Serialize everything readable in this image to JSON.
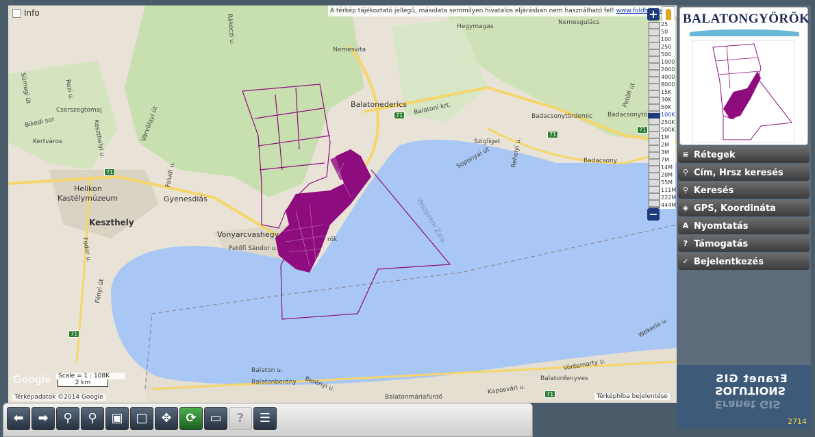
{
  "map": {
    "info_label": "Info",
    "disclaimer": "A térkép tájékoztató jellegű, másolata semmilyen hivatalos eljárásban nem használható fel!",
    "disclaimer_link": "www.foldhivatal.hu",
    "scale_text": "Scale = 1 : 108K",
    "scale_bar": "2 km",
    "google_logo": "Google",
    "map_data": "Térképadatok ©2014 Google",
    "report_error": "Térképhiba bejelentése",
    "labels": {
      "hegymagas": "Hegymagas",
      "nemesgulacs": "Nemesgulács",
      "rakoczi": "Rákóczi u.",
      "nemesvita": "Nemesvita",
      "balatonederics": "Balatonederics",
      "balatoni_krt": "Balatoni krt.",
      "szigliget": "Szigliget",
      "badacsonytordemic": "Badacsonytördemic",
      "badacsonyto": "Badacsonytó",
      "badacsony": "Badacsony",
      "cserszegtomaj": "Cserszegtomaj",
      "kertvaros": "Kertváros",
      "helikon": "Helikon",
      "kastelymuzeum": "Kastélymúzeum",
      "keszthely": "Keszthely",
      "gyenesdias": "Gyenesdiás",
      "vonyarcvashegy": "Vonyarcvashegy",
      "petofi": "Petőfi Sándor u.",
      "gyorok": "rök",
      "veszprem_zala": "Veszprém Zala",
      "balatonbereny": "Balatonberény",
      "balatonmariafurdo": "Balatonmáriafürdő",
      "balatonfenyves": "Balatonfenyves",
      "vorosmarty": "Vörösmarty u.",
      "kaposvari": "Kaposvári u.",
      "wekerle": "Wekerle u.",
      "berenyi": "Berényi u.",
      "balaton_u": "Balaton u.",
      "fenyi": "Fényi út",
      "fodor": "Fodor u.",
      "sumegi": "Sümegi út",
      "rezi": "Rezi u.",
      "bikedi": "Bikedi sor",
      "faludi": "Faludi u.",
      "varvolgyi": "Várvölgyi út",
      "kert_u": "Keszthelyi u.",
      "petofi_ut": "Petőfi út",
      "soponyai": "Soponyai út",
      "rehelyi": "Rehelyi u."
    },
    "road_number": "71"
  },
  "zoom": {
    "plus": "+",
    "minus": "−",
    "scales": [
      "25",
      "50",
      "100",
      "250",
      "500",
      "1000",
      "2000",
      "4000",
      "8000",
      "15K",
      "30K",
      "50K",
      "100K",
      "250K",
      "500K",
      "1M",
      "2M",
      "3M",
      "7M",
      "14M",
      "28M",
      "55M",
      "111M",
      "222M",
      "444M"
    ],
    "active_scale": "100K"
  },
  "panel": {
    "logo_title": "BALATONGYÖRÖK",
    "menu": [
      {
        "icon": "layers-icon",
        "glyph": "≡",
        "label": "Rétegek"
      },
      {
        "icon": "magnifier-icon",
        "glyph": "⚲",
        "label": "Cím, Hrsz keresés"
      },
      {
        "icon": "magnifier-icon",
        "glyph": "⚲",
        "label": "Keresés"
      },
      {
        "icon": "gps-icon",
        "glyph": "◈",
        "label": "GPS, Koordináta"
      },
      {
        "icon": "print-icon",
        "glyph": "A",
        "label": "Nyomtatás"
      },
      {
        "icon": "help-icon",
        "glyph": "?",
        "label": "Támogatás"
      },
      {
        "icon": "login-icon",
        "glyph": "✓",
        "label": "Bejelentkezés"
      }
    ],
    "brand_line1": "Eranet GIS",
    "brand_line2": "SOLUTIONS",
    "counter": "2714"
  },
  "toolbar": {
    "buttons": [
      "back-arrow",
      "forward-arrow",
      "zoom-in",
      "zoom-out",
      "zoom-box",
      "full-extent",
      "pan",
      "refresh",
      "measure",
      "identify",
      "report"
    ]
  },
  "colors": {
    "water": "#a9c7f5",
    "land": "#e8e3d6",
    "forest": "#c8dfb0",
    "parcel": "#8e0c7e",
    "road": "#f6d66a"
  }
}
